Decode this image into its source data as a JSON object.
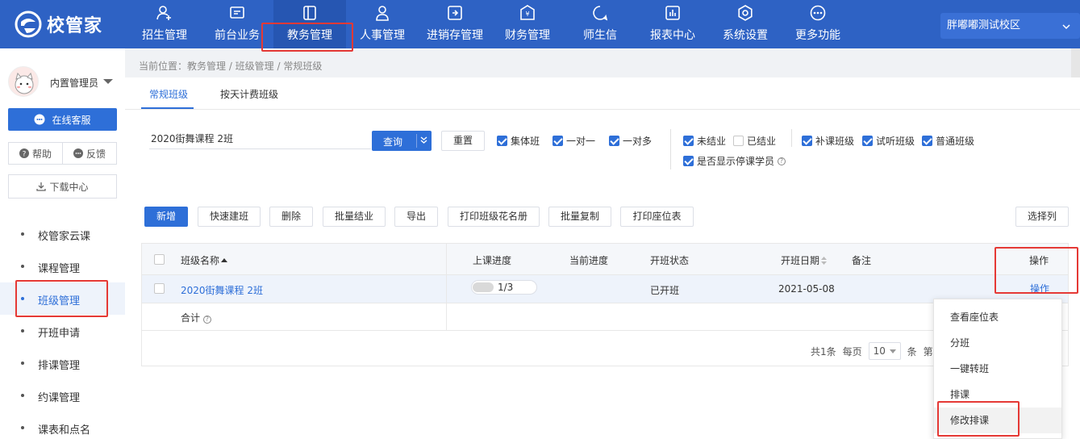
{
  "app": {
    "logo_text": "校管家",
    "campus": "胖嘟嘟测试校区"
  },
  "nav": [
    {
      "label": "招生管理",
      "icon": "user-add-icon"
    },
    {
      "label": "前台业务",
      "icon": "monitor-icon"
    },
    {
      "label": "教务管理",
      "icon": "book-icon"
    },
    {
      "label": "人事管理",
      "icon": "person-icon"
    },
    {
      "label": "进销存管理",
      "icon": "inventory-icon"
    },
    {
      "label": "财务管理",
      "icon": "yen-shield-icon"
    },
    {
      "label": "师生信",
      "icon": "message-icon"
    },
    {
      "label": "报表中心",
      "icon": "report-icon"
    },
    {
      "label": "系统设置",
      "icon": "gear-icon"
    },
    {
      "label": "更多功能",
      "icon": "more-icon"
    }
  ],
  "sidebar": {
    "user_name": "内置管理员",
    "online_service": "在线客服",
    "help": "帮助",
    "feedback": "反馈",
    "download": "下载中心",
    "items": [
      {
        "label": "校管家云课"
      },
      {
        "label": "课程管理"
      },
      {
        "label": "班级管理"
      },
      {
        "label": "开班申请"
      },
      {
        "label": "排课管理"
      },
      {
        "label": "约课管理"
      },
      {
        "label": "课表和点名"
      }
    ]
  },
  "breadcrumb": "当前位置：教务管理 / 班级管理 / 常规班级",
  "tabs": [
    {
      "label": "常规班级"
    },
    {
      "label": "按天计费班级"
    }
  ],
  "filters": {
    "search_value": "2020街舞课程 2班",
    "query": "查询",
    "reset": "重置",
    "checks": [
      {
        "label": "集体班",
        "checked": true
      },
      {
        "label": "一对一",
        "checked": true
      },
      {
        "label": "一对多",
        "checked": true
      },
      {
        "label": "未结业",
        "checked": true
      },
      {
        "label": "已结业",
        "checked": false
      },
      {
        "label": "是否显示停课学员",
        "checked": true
      },
      {
        "label": "补课班级",
        "checked": true
      },
      {
        "label": "试听班级",
        "checked": true
      },
      {
        "label": "普通班级",
        "checked": true
      }
    ]
  },
  "actions": {
    "add": "新增",
    "quick": "快速建班",
    "delete": "删除",
    "batch_finish": "批量结业",
    "export": "导出",
    "print_roster": "打印班级花名册",
    "batch_copy": "批量复制",
    "print_seat": "打印座位表",
    "choose_cols": "选择列"
  },
  "table": {
    "headers": {
      "name": "班级名称",
      "progress": "上课进度",
      "current": "当前进度",
      "status": "开班状态",
      "date": "开班日期",
      "note": "备注",
      "op": "操作"
    },
    "rows": [
      {
        "name": "2020街舞课程 2班",
        "progress_text": "1/3",
        "progress": 0.333,
        "current": "",
        "status": "已开班",
        "date": "2021-05-08",
        "note": "",
        "op": "操作"
      }
    ],
    "total_label": "合计"
  },
  "pager": {
    "total": "共1条",
    "per_page_label": "每页",
    "per_page": "10",
    "unit": "条",
    "trailing": "第"
  },
  "popup": [
    {
      "label": "查看座位表"
    },
    {
      "label": "分班"
    },
    {
      "label": "一键转班"
    },
    {
      "label": "排课"
    },
    {
      "label": "修改排课"
    }
  ],
  "colors": {
    "brand": "#2e62c4",
    "primary": "#2e6fd8",
    "highlight": "#e53935"
  }
}
